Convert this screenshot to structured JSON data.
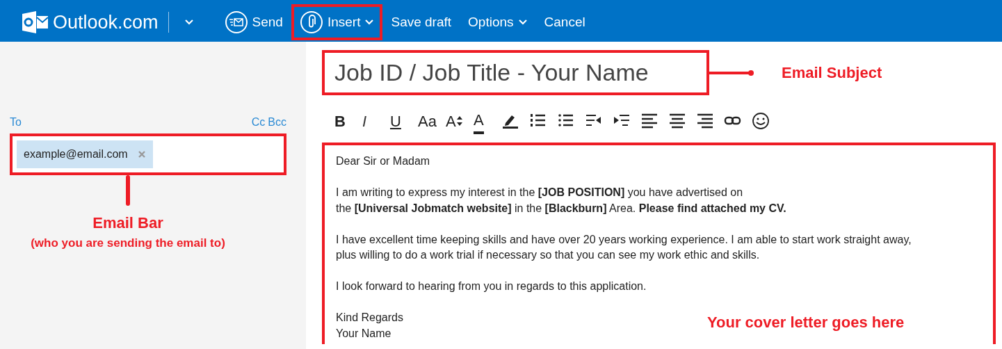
{
  "header": {
    "logo": "Outlook.com",
    "actions": [
      {
        "kind": "send",
        "label": "Send",
        "highlighted": false,
        "menu": false
      },
      {
        "kind": "attach",
        "label": "Insert",
        "highlighted": true,
        "menu": true
      },
      {
        "kind": "plain",
        "label": "Save draft",
        "highlighted": false,
        "menu": false
      },
      {
        "kind": "plain",
        "label": "Options",
        "highlighted": false,
        "menu": true
      },
      {
        "kind": "plain",
        "label": "Cancel",
        "highlighted": false,
        "menu": false
      }
    ]
  },
  "recipients": {
    "to_label": "To",
    "cc_links": [
      "Cc",
      "Bcc"
    ],
    "highlighted": true,
    "annotation": {
      "text": "Email Bar",
      "note": "(who you are sending the email to)"
    },
    "chips": [
      {
        "address": "example@email.com"
      }
    ]
  },
  "subject": {
    "value": "Job ID / Job Title - Your Name",
    "highlighted": true,
    "annotation": {
      "text": "Email Subject"
    }
  },
  "format_tools": [
    {
      "kind": "bold",
      "label": "B"
    },
    {
      "kind": "italic",
      "label": "I"
    },
    {
      "kind": "underline",
      "label": "U"
    },
    {
      "kind": "font",
      "label": "Aa"
    },
    {
      "kind": "size",
      "label": "A"
    },
    {
      "kind": "color",
      "label": "A"
    },
    {
      "kind": "highlight"
    },
    {
      "kind": "numbered"
    },
    {
      "kind": "bullets"
    },
    {
      "kind": "outdent"
    },
    {
      "kind": "indent"
    },
    {
      "kind": "align-left"
    },
    {
      "kind": "align-center"
    },
    {
      "kind": "align-right"
    },
    {
      "kind": "link"
    },
    {
      "kind": "emoji"
    }
  ],
  "body": {
    "highlighted": true,
    "annotation": {
      "text": "Your cover letter goes here"
    },
    "paragraphs": [
      [
        "Dear Sir or Madam"
      ],
      [
        "I am writing to express my interest in the **[JOB POSITION]** you have advertised on",
        "the **[Universal Jobmatch website]** in the **[Blackburn]** Area. **Please find attached my CV.**"
      ],
      [
        "I have excellent time keeping skills and have over 20 years working experience. I am able to start work straight away,",
        "plus willing to do a work trial if necessary so that you can see my work ethic and skills."
      ],
      [
        "I look forward to hearing from you in regards to this application."
      ],
      [
        "Kind Regards",
        "Your Name"
      ]
    ]
  }
}
